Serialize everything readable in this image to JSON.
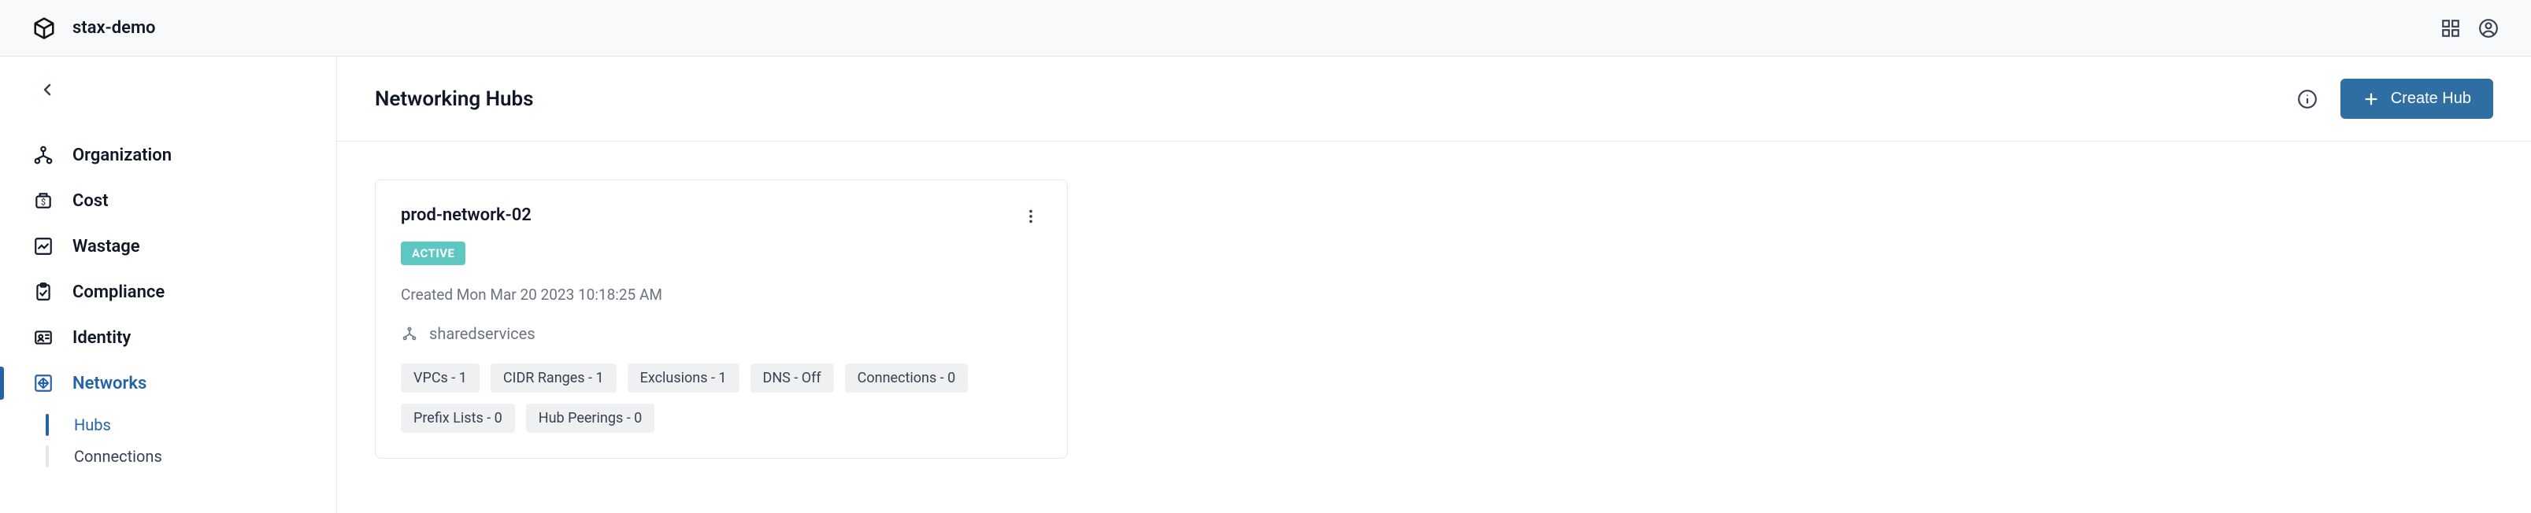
{
  "topbar": {
    "title": "stax-demo"
  },
  "sidebar": {
    "items": [
      {
        "label": "Organization",
        "active": false
      },
      {
        "label": "Cost",
        "active": false
      },
      {
        "label": "Wastage",
        "active": false
      },
      {
        "label": "Compliance",
        "active": false
      },
      {
        "label": "Identity",
        "active": false
      },
      {
        "label": "Networks",
        "active": true
      }
    ],
    "sub": [
      {
        "label": "Hubs",
        "active": true
      },
      {
        "label": "Connections",
        "active": false
      }
    ]
  },
  "page": {
    "title": "Networking Hubs",
    "create_label": "Create Hub"
  },
  "hub": {
    "name": "prod-network-02",
    "status": "ACTIVE",
    "created": "Created Mon Mar 20 2023 10:18:25 AM",
    "org": "sharedservices",
    "tags": [
      "VPCs - 1",
      "CIDR Ranges - 1",
      "Exclusions - 1",
      "DNS - Off",
      "Connections - 0",
      "Prefix Lists - 0",
      "Hub Peerings - 0"
    ]
  }
}
